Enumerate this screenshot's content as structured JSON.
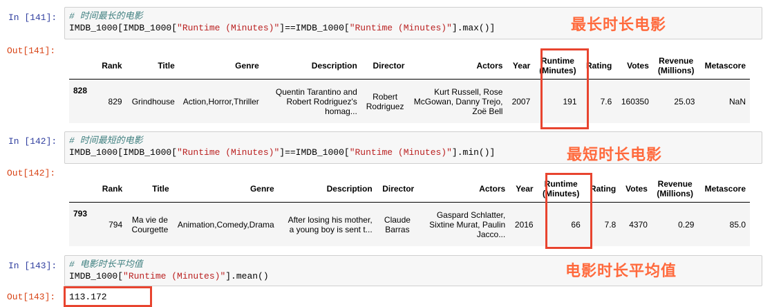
{
  "cells": [
    {
      "in_prompt": "In [141]:",
      "comment": "# 时间最长的电影",
      "code": {
        "p1": "IMDB_1000[IMDB_1000[",
        "s1": "\"Runtime (Minutes)\"",
        "p2": "]==IMDB_1000[",
        "s2": "\"Runtime (Minutes)\"",
        "p3": "].max()]"
      },
      "out_prompt": "Out[141]:",
      "annotation": "最长时长电影",
      "row": {
        "index": "828",
        "rank": "829",
        "title": "Grindhouse",
        "genre": "Action,Horror,Thriller",
        "desc1": "Quentin Tarantino and",
        "desc2": "Robert Rodriguez's",
        "desc3": "homag...",
        "dir1": "Robert",
        "dir2": "Rodriguez",
        "act1": "Kurt Russell, Rose",
        "act2": "McGowan, Danny Trejo,",
        "act3": "Zoë Bell",
        "year": "2007",
        "runtime": "191",
        "rating": "7.6",
        "votes": "160350",
        "revenue": "25.03",
        "metascore": "NaN"
      }
    },
    {
      "in_prompt": "In [142]:",
      "comment": "# 时间最短的电影",
      "code": {
        "p1": "IMDB_1000[IMDB_1000[",
        "s1": "\"Runtime (Minutes)\"",
        "p2": "]==IMDB_1000[",
        "s2": "\"Runtime (Minutes)\"",
        "p3": "].min()]"
      },
      "out_prompt": "Out[142]:",
      "annotation": "最短时长电影",
      "row": {
        "index": "793",
        "rank": "794",
        "title1": "Ma vie de",
        "title2": "Courgette",
        "genre": "Animation,Comedy,Drama",
        "desc1": "After losing his mother,",
        "desc2": "a young boy is sent t...",
        "dir1": "Claude",
        "dir2": "Barras",
        "act1": "Gaspard Schlatter,",
        "act2": "Sixtine Murat, Paulin",
        "act3": "Jacco...",
        "year": "2016",
        "runtime": "66",
        "rating": "7.8",
        "votes": "4370",
        "revenue": "0.29",
        "metascore": "85.0"
      }
    },
    {
      "in_prompt": "In [143]:",
      "comment": "# 电影时长平均值",
      "code": {
        "p1": "IMDB_1000[",
        "s1": "\"Runtime (Minutes)\"",
        "p2": "].mean()"
      },
      "out_prompt": "Out[143]:",
      "annotation": "电影时长平均值",
      "output": "113.172"
    }
  ],
  "columns": {
    "rank": "Rank",
    "title": "Title",
    "genre": "Genre",
    "description": "Description",
    "director": "Director",
    "actors": "Actors",
    "year": "Year",
    "runtime1": "Runtime",
    "runtime2": "(Minutes)",
    "rating": "Rating",
    "votes": "Votes",
    "revenue1": "Revenue",
    "revenue2": "(Millions)",
    "metascore": "Metascore"
  },
  "colors": {
    "annotation": "#ff6a3d",
    "highlight_box": "#e8442f",
    "in_prompt": "#303f9f",
    "out_prompt": "#d84315"
  }
}
